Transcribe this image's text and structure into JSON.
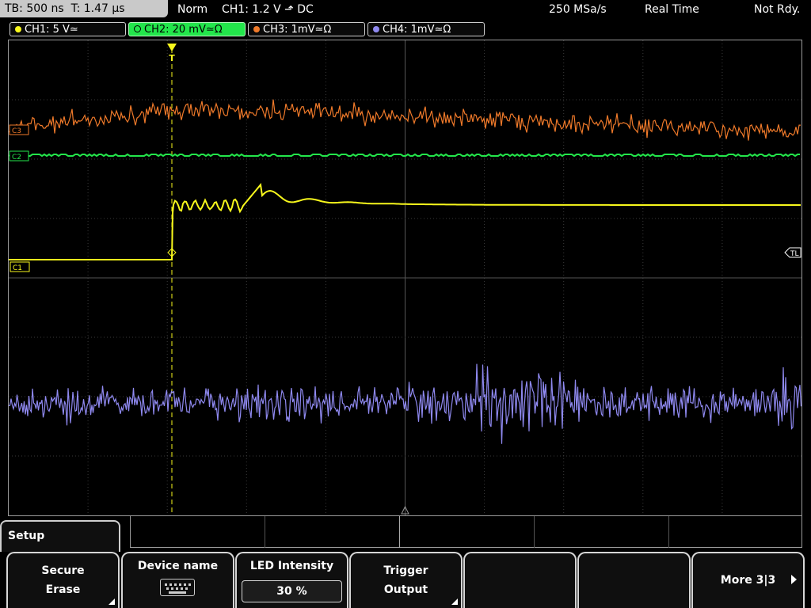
{
  "topbar": {
    "timebase": "TB: 500 ns",
    "trigger_time": "T: 1.47 µs",
    "mode": "Norm",
    "trigger_setting": "CH1: 1.2 V ⬏ DC",
    "sample_rate": "250 MSa/s",
    "acq_mode": "Real Time",
    "status": "Not Rdy."
  },
  "channels": [
    {
      "id": "CH1",
      "label": "CH1: 5 V≃",
      "color": "#f8f81c"
    },
    {
      "id": "CH2",
      "label": "CH2: 20 mV≃Ω",
      "color": "#23e64b",
      "active": true
    },
    {
      "id": "CH3",
      "label": "CH3: 1mV≃Ω",
      "color": "#f07a2a"
    },
    {
      "id": "CH4",
      "label": "CH4: 1mV≃Ω",
      "color": "#8f89f0"
    }
  ],
  "screen_markers": {
    "trigger_marker": "T",
    "trigger_level": "TL",
    "ch1_marker": "C1",
    "ch2_marker": "C2",
    "ch3_marker": "C3"
  },
  "menu": {
    "title": "Setup",
    "softkeys": [
      {
        "line1": "Secure",
        "line2": "Erase"
      },
      {
        "line1": "Device name",
        "icon": "keyboard-icon"
      },
      {
        "line1": "LED Intensity",
        "value": "30 %"
      },
      {
        "line1": "Trigger",
        "line2": "Output"
      },
      {
        "line1": ""
      },
      {
        "line1": ""
      },
      {
        "line1": "More 3|3"
      }
    ]
  },
  "colors": {
    "ch1": "#f8f81c",
    "ch2": "#23e64b",
    "ch3": "#f07a2a",
    "ch4": "#8f89f0",
    "grid": "#3a3a3a"
  }
}
